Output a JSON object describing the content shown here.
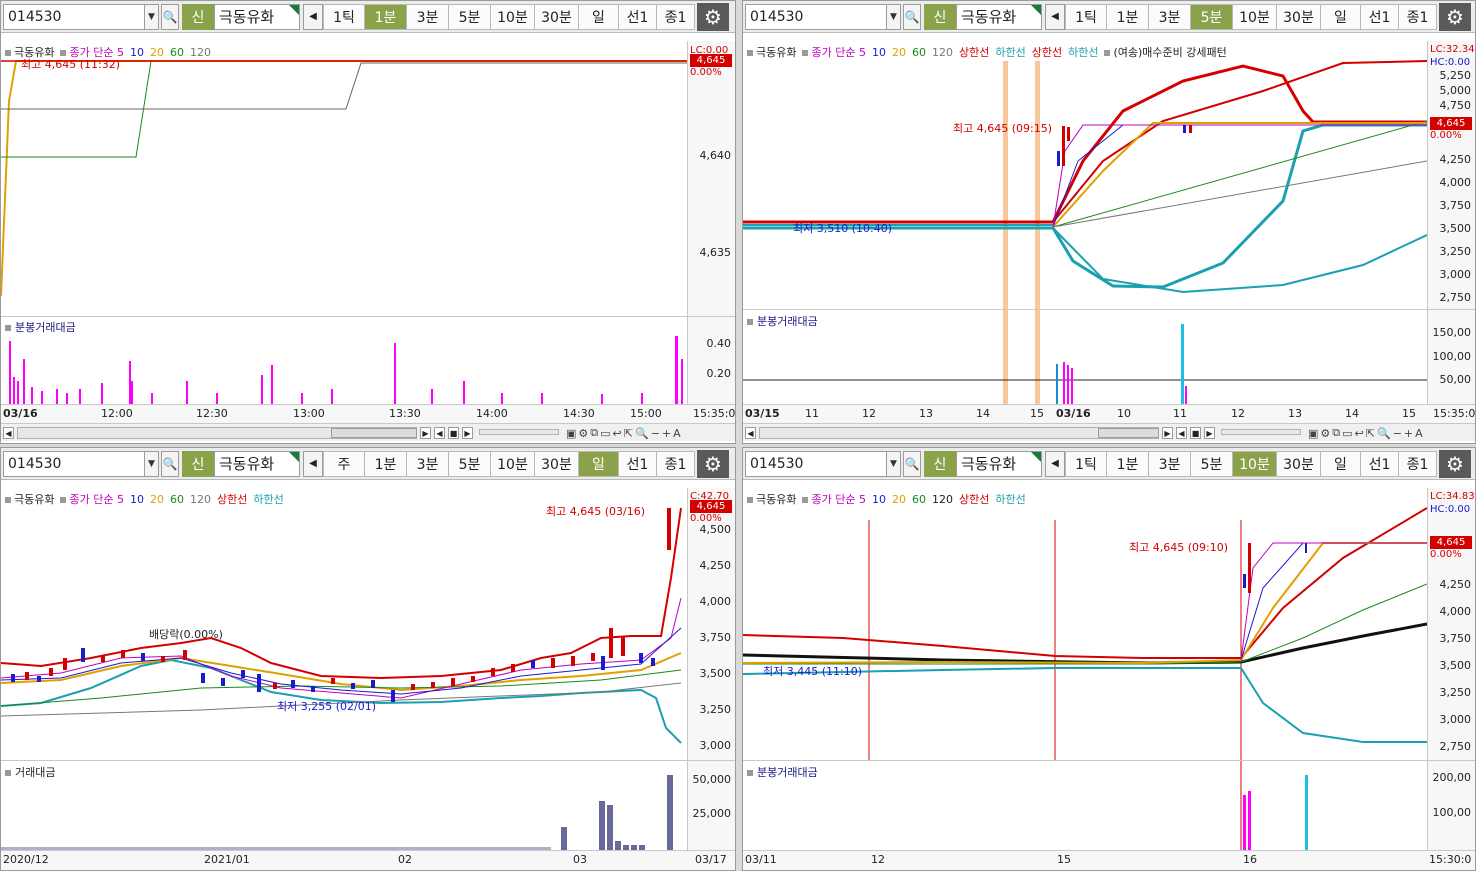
{
  "panels": [
    {
      "code": "014530",
      "name": "극동유화",
      "new_label": "신",
      "periods": [
        "1틱",
        "1분",
        "3분",
        "5분",
        "10분",
        "30분",
        "일",
        "선1",
        "종1"
      ],
      "active_period": "1분",
      "legend": [
        {
          "text": "극동유화",
          "color": "#222"
        },
        {
          "text": "종가 단순 5",
          "color": "#c000c0"
        },
        {
          "text": "10",
          "color": "#1a1ad0"
        },
        {
          "text": "20",
          "color": "#e0a000"
        },
        {
          "text": "60",
          "color": "#1a8a1a"
        },
        {
          "text": "120",
          "color": "#777"
        }
      ],
      "high_note": "최고 4,645 (11:32)",
      "axis_labels": [
        "4,640",
        "4,635"
      ],
      "vol_axis_labels": [
        "0.40",
        "0.20"
      ],
      "lc_text": "LC:0.00",
      "price": "4,645",
      "pct": "0.00%",
      "vol_title": "분봉거래대금",
      "x_labels": [
        "03/16",
        "12:00",
        "12:30",
        "13:00",
        "13:30",
        "14:00",
        "14:30",
        "15:00",
        "15:35:0"
      ]
    },
    {
      "code": "014530",
      "name": "극동유화",
      "new_label": "신",
      "periods": [
        "1틱",
        "1분",
        "3분",
        "5분",
        "10분",
        "30분",
        "일",
        "선1",
        "종1"
      ],
      "active_period": "5분",
      "legend": [
        {
          "text": "극동유화",
          "color": "#222"
        },
        {
          "text": "종가 단순 5",
          "color": "#c000c0"
        },
        {
          "text": "10",
          "color": "#1a1ad0"
        },
        {
          "text": "20",
          "color": "#e0a000"
        },
        {
          "text": "60",
          "color": "#1a8a1a"
        },
        {
          "text": "120",
          "color": "#777"
        },
        {
          "text": "상한선",
          "color": "#d40000"
        },
        {
          "text": "하한선",
          "color": "#1aa0b0"
        },
        {
          "text": "상한선",
          "color": "#d40000"
        },
        {
          "text": "하한선",
          "color": "#1aa0b0"
        },
        {
          "text": "(여송)매수준비 강세패턴",
          "color": "#222"
        }
      ],
      "high_note": "최고 4,645 (09:15)",
      "low_note": "최저 3,510 (10:40)",
      "axis_labels": [
        "5,250",
        "5,000",
        "4,750",
        "4,500",
        "4,250",
        "4,000",
        "3,750",
        "3,500",
        "3,250",
        "3,000",
        "2,750"
      ],
      "vol_axis_labels": [
        "150,00",
        "100,00",
        "50,00"
      ],
      "lc_text": "LC:32.34",
      "hc_text": "HC:0.00",
      "price": "4,645",
      "pct": "0.00%",
      "vol_title": "분봉거래대금",
      "x_labels": [
        "03/15",
        "11",
        "12",
        "13",
        "14",
        "15",
        "03/16",
        "10",
        "11",
        "12",
        "13",
        "14",
        "15",
        "15:35:0"
      ]
    },
    {
      "code": "014530",
      "name": "극동유화",
      "new_label": "신",
      "periods": [
        "주",
        "1분",
        "3분",
        "5분",
        "10분",
        "30분",
        "일",
        "선1",
        "종1"
      ],
      "active_period": "일",
      "legend": [
        {
          "text": "극동유화",
          "color": "#222"
        },
        {
          "text": "종가 단순 5",
          "color": "#c000c0"
        },
        {
          "text": "10",
          "color": "#1a1ad0"
        },
        {
          "text": "20",
          "color": "#e0a000"
        },
        {
          "text": "60",
          "color": "#1a8a1a"
        },
        {
          "text": "120",
          "color": "#777"
        },
        {
          "text": "상한선",
          "color": "#d40000"
        },
        {
          "text": "하한선",
          "color": "#1aa0b0"
        }
      ],
      "high_note": "최고 4,645 (03/16)",
      "low_note": "최저 3,255 (02/01)",
      "div_note": "배당락(0.00%)",
      "axis_labels": [
        "4,500",
        "4,250",
        "4,000",
        "3,750",
        "3,500",
        "3,250",
        "3,000"
      ],
      "vol_axis_labels": [
        "50,000",
        "25,000"
      ],
      "lc_text": "C:42.70",
      "price": "4,645",
      "pct": "0.00%",
      "vol_title": "거래대금",
      "x_labels": [
        "2020/12",
        "2021/01",
        "02",
        "03",
        "03/17"
      ]
    },
    {
      "code": "014530",
      "name": "극동유화",
      "new_label": "신",
      "periods": [
        "1틱",
        "1분",
        "3분",
        "5분",
        "10분",
        "30분",
        "일",
        "선1",
        "종1"
      ],
      "active_period": "10분",
      "legend": [
        {
          "text": "극동유화",
          "color": "#222"
        },
        {
          "text": "종가 단순 5",
          "color": "#c000c0"
        },
        {
          "text": "10",
          "color": "#1a1ad0"
        },
        {
          "text": "20",
          "color": "#e0a000"
        },
        {
          "text": "60",
          "color": "#1a8a1a"
        },
        {
          "text": "120",
          "color": "#222"
        },
        {
          "text": "상한선",
          "color": "#d40000"
        },
        {
          "text": "하한선",
          "color": "#1aa0b0"
        }
      ],
      "high_note": "최고 4,645 (09:10)",
      "low_note": "최저 3,445 (11:10)",
      "axis_labels": [
        "4,500",
        "4,250",
        "4,000",
        "3,750",
        "3,500",
        "3,250",
        "3,000",
        "2,750"
      ],
      "vol_axis_labels": [
        "200,00",
        "100,00"
      ],
      "lc_text": "LC:34.83",
      "hc_text": "HC:0.00",
      "price": "4,645",
      "pct": "0.00%",
      "vol_title": "분봉거래대금",
      "x_labels": [
        "03/11",
        "12",
        "15",
        "16",
        "15:30:0"
      ]
    }
  ]
}
